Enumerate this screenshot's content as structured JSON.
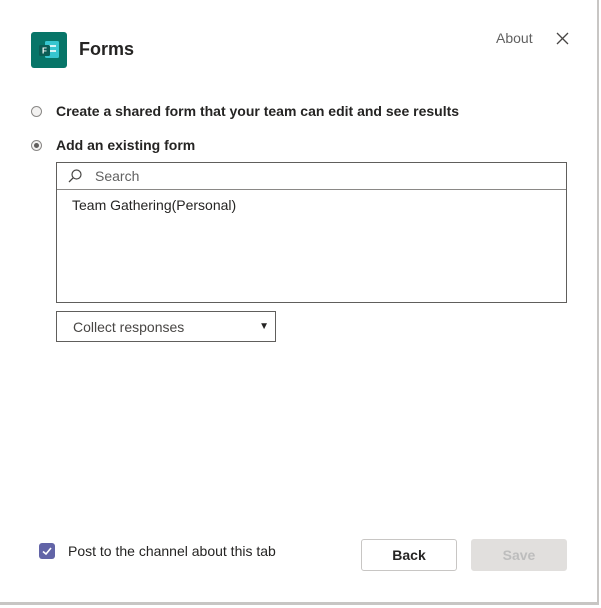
{
  "header": {
    "app_title": "Forms",
    "about_label": "About",
    "app_icon_letter": "F",
    "icon": "forms-app-icon",
    "accent": "#077568"
  },
  "options": [
    {
      "label": "Create a shared form that your team can edit and see results",
      "selected": false
    },
    {
      "label": "Add an existing form",
      "selected": true
    }
  ],
  "form_picker": {
    "search_placeholder": "Search",
    "search_value": "",
    "items": [
      "Team Gathering(Personal)"
    ]
  },
  "mode_select": {
    "value": "Collect responses"
  },
  "footer": {
    "post_label": "Post to the channel about this tab",
    "post_checked": true,
    "back_label": "Back",
    "save_label": "Save",
    "checkbox_color": "#6264a7"
  }
}
